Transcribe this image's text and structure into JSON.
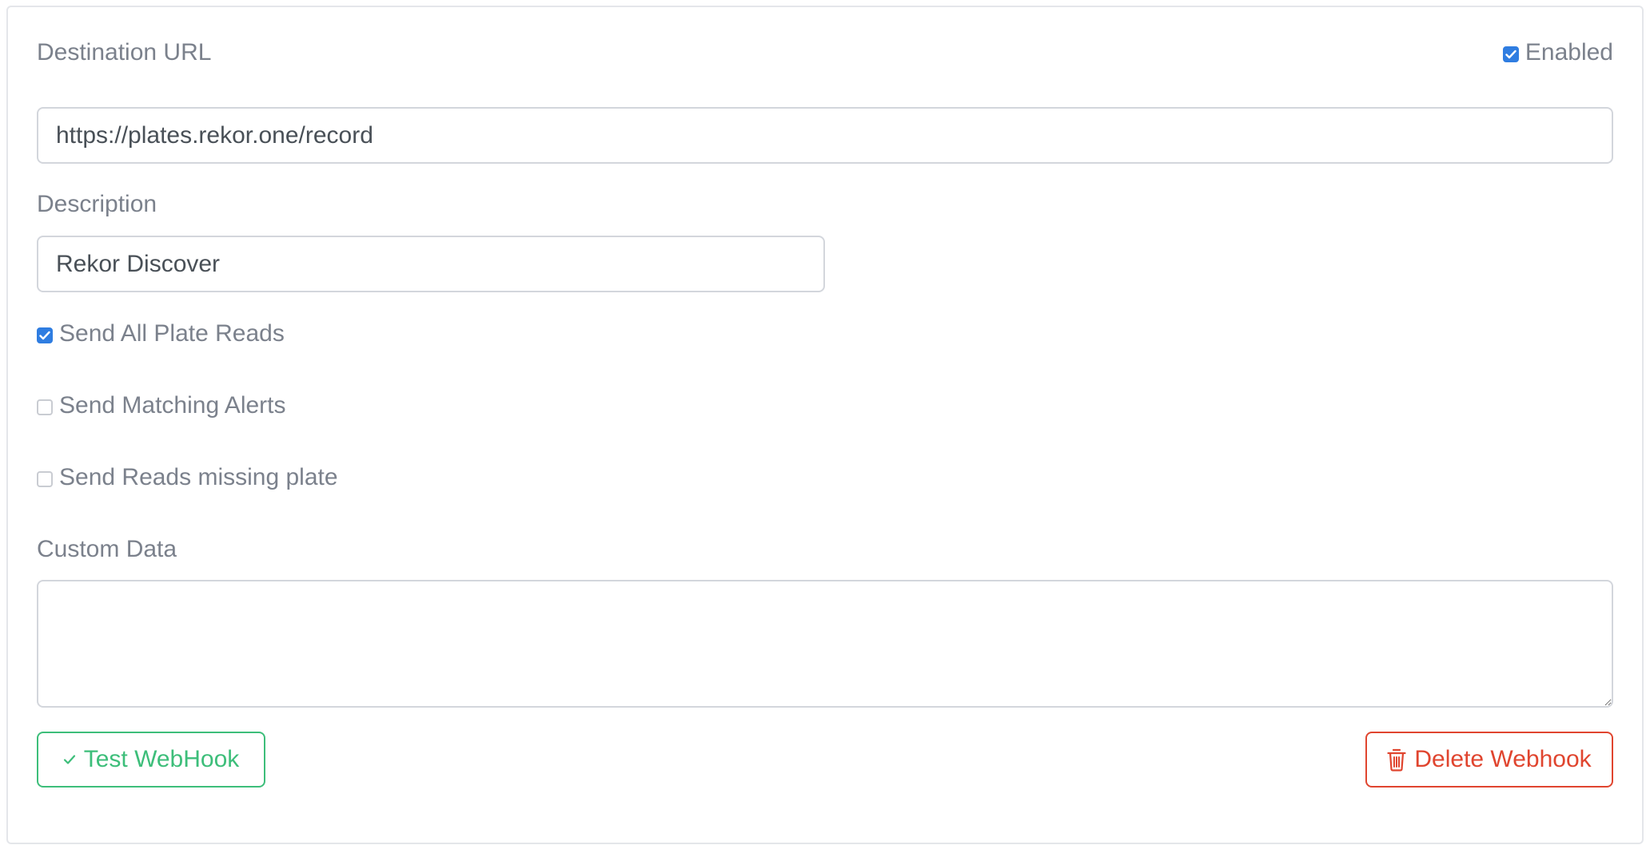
{
  "form": {
    "destination_label": "Destination URL",
    "enabled_label": "Enabled",
    "enabled_checked": true,
    "destination_value": "https://plates.rekor.one/record",
    "description_label": "Description",
    "description_value": "Rekor Discover",
    "options": [
      {
        "label": "Send All Plate Reads",
        "checked": true
      },
      {
        "label": "Send Matching Alerts",
        "checked": false
      },
      {
        "label": "Send Reads missing plate",
        "checked": false
      }
    ],
    "custom_data_label": "Custom Data",
    "custom_data_value": ""
  },
  "buttons": {
    "test_label": "Test WebHook",
    "test_icon": "check-icon",
    "delete_label": "Delete Webhook",
    "delete_icon": "trash-icon"
  },
  "colors": {
    "checkbox_accent": "#2f7de1",
    "success": "#3dbe7a",
    "danger": "#e0452f"
  }
}
